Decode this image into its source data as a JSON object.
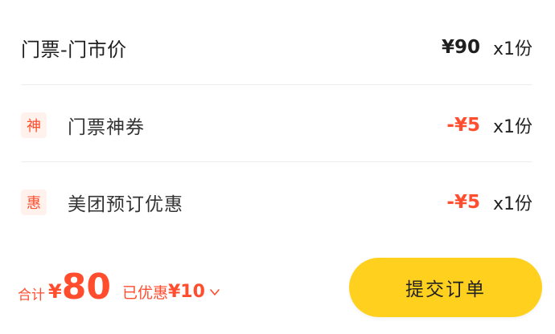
{
  "ticket": {
    "title": "门票-门市价",
    "price": "¥90",
    "qty": "x1份"
  },
  "discounts": [
    {
      "badge": "神",
      "label": "门票神券",
      "amount": "-¥5",
      "qty": "x1份"
    },
    {
      "badge": "惠",
      "label": "美团预订优惠",
      "amount": "-¥5",
      "qty": "x1份"
    }
  ],
  "footer": {
    "total_label": "合计",
    "currency": "¥",
    "total_amount": "80",
    "saved_label": "已优惠",
    "saved_amount": "¥10",
    "submit_label": "提交订单"
  },
  "colors": {
    "accent_red": "#ff4d2e",
    "button_yellow": "#ffd11e"
  }
}
